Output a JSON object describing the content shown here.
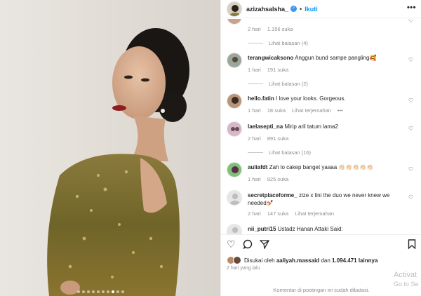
{
  "header": {
    "username": "azizahsalsha_",
    "separator": "•",
    "follow_label": "Ikuti",
    "more_label": "•••"
  },
  "comments_top": {
    "meta_time": "2 hari",
    "meta_likes": "1.156 suka",
    "replies": "Lihat balasan (4)"
  },
  "comments": [
    {
      "username": "terangwicaksono",
      "text": "Anggun bund sampe pangling🥰",
      "time": "1 hari",
      "likes": "191 suka",
      "extra": "",
      "replies": "Lihat balasan (2)"
    },
    {
      "username": "hello.fatin",
      "text": "I love your looks. Gorgeous.",
      "time": "1 hari",
      "likes": "18 suka",
      "extra": "Lihat terjemahan",
      "more": "•••",
      "replies": ""
    },
    {
      "username": "laelasepti_na",
      "text": "Mirip aril tatum lama2",
      "time": "2 hari",
      "likes": "891 suka",
      "extra": "",
      "replies": "Lihat balasan (16)"
    },
    {
      "username": "auliafdt",
      "text": "Zah lo cakep banget yaaaa 👏🏻👏🏻👏🏻👏🏻👏🏻",
      "time": "1 hari",
      "likes": "925 suka",
      "extra": "",
      "replies": ""
    },
    {
      "username": "secretplaceforme_",
      "text": "zize x lini the duo we never knew we needed💅🏻",
      "time": "2 hari",
      "likes": "147 suka",
      "extra": "Lihat terjemahan",
      "replies": ""
    },
    {
      "username": "nii_putri15",
      "text": "Ustadz Hanan Attaki Said:",
      "time": "",
      "likes": "",
      "extra": "",
      "replies": ""
    }
  ],
  "actions": {
    "liked_prefix": "Disukai oleh",
    "liked_user": "aaliyah.massaid",
    "liked_and": "dan",
    "liked_count": "1.094.471 lainnya",
    "posted_ago": "2 hari yang lalu",
    "comments_disabled": "Komentar di postingan ini sudah dibatasi."
  },
  "watermark": {
    "line1": "Activat",
    "line2": "Go to Se"
  },
  "icons": {
    "like": "heart-icon",
    "comment": "comment-icon",
    "share": "share-icon",
    "save": "bookmark-icon",
    "verified": "verified-badge-icon"
  },
  "colors": {
    "accent": "#0095f6",
    "verified": "#3897f0",
    "text": "#262626",
    "muted": "#8e8e8e"
  }
}
